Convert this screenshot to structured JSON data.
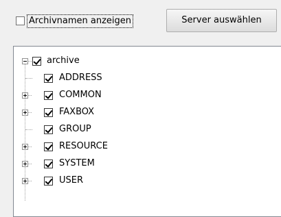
{
  "options": {
    "show_archive_names_label": "Archivnamen anzeigen",
    "show_archive_names_checked": false
  },
  "toolbar": {
    "select_server_label": "Server auswählen"
  },
  "tree": {
    "root": {
      "label": "archive",
      "checked": true,
      "expanded": true
    },
    "children": [
      {
        "label": "ADDRESS",
        "checked": true,
        "expandable": false
      },
      {
        "label": "COMMON",
        "checked": true,
        "expandable": true
      },
      {
        "label": "FAXBOX",
        "checked": true,
        "expandable": true
      },
      {
        "label": "GROUP",
        "checked": true,
        "expandable": false
      },
      {
        "label": "RESOURCE",
        "checked": true,
        "expandable": true
      },
      {
        "label": "SYSTEM",
        "checked": true,
        "expandable": true
      },
      {
        "label": "USER",
        "checked": true,
        "expandable": true
      }
    ]
  }
}
